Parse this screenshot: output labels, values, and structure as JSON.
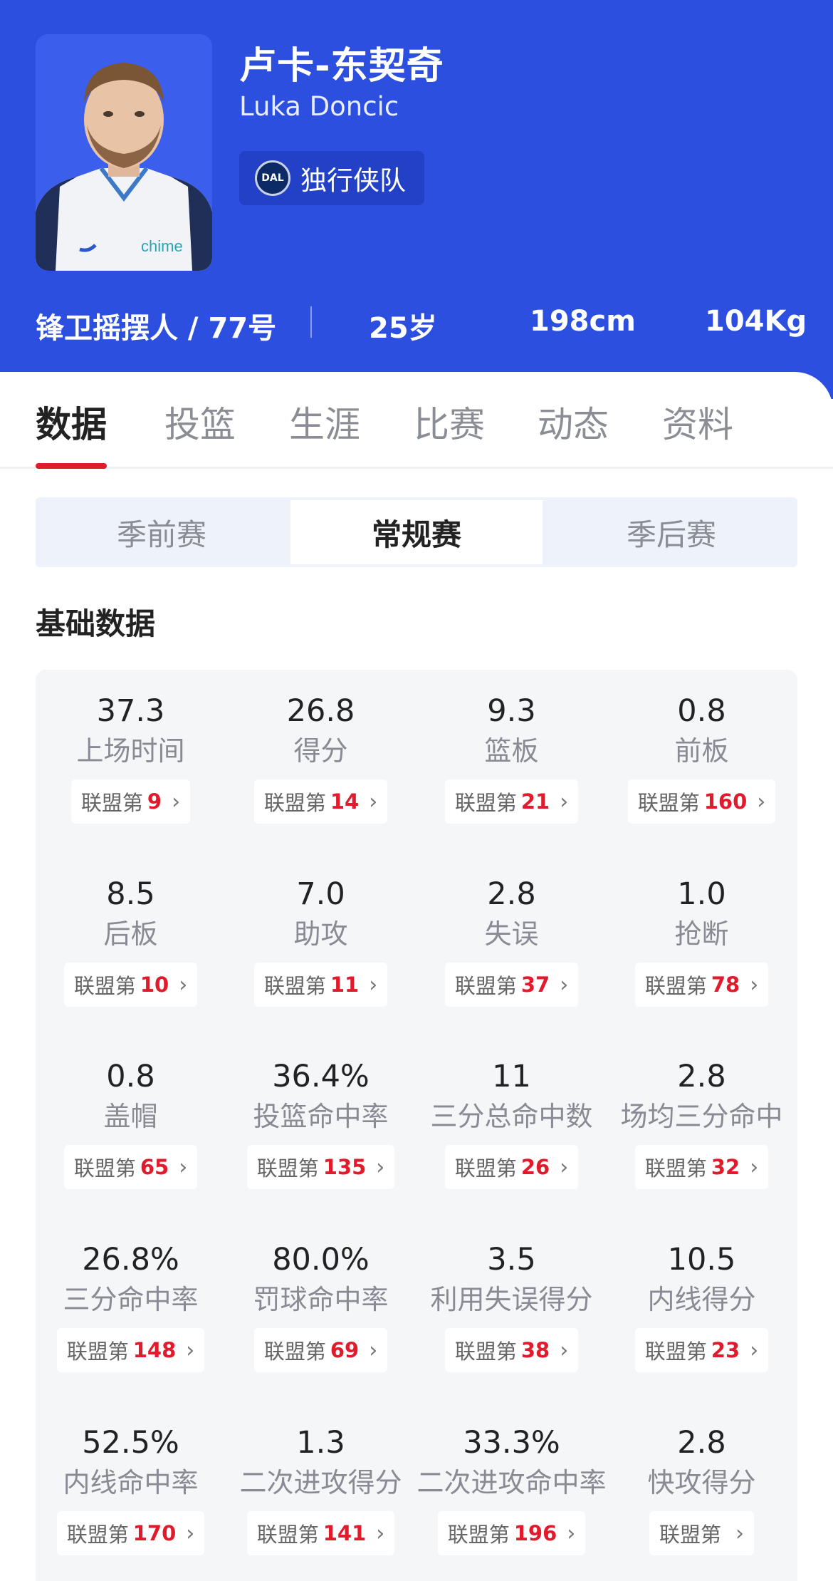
{
  "player": {
    "name_cn": "卢卡-东契奇",
    "name_en": "Luka Doncic",
    "team": "独行侠队",
    "team_logo_text": "DAL",
    "jersey_text": "chime",
    "position_number": "锋卫摇摆人 / 77号",
    "age": "25岁",
    "height": "198cm",
    "weight": "104Kg"
  },
  "tabs": [
    "数据",
    "投篮",
    "生涯",
    "比赛",
    "动态",
    "资料"
  ],
  "season_types": [
    "季前赛",
    "常规赛",
    "季后赛"
  ],
  "active_season_type": "常规赛",
  "section_title": "基础数据",
  "rank_prefix": "联盟第",
  "stats": [
    {
      "value": "37.3",
      "label": "上场时间",
      "rank": "9"
    },
    {
      "value": "26.8",
      "label": "得分",
      "rank": "14"
    },
    {
      "value": "9.3",
      "label": "篮板",
      "rank": "21"
    },
    {
      "value": "0.8",
      "label": "前板",
      "rank": "160"
    },
    {
      "value": "8.5",
      "label": "后板",
      "rank": "10"
    },
    {
      "value": "7.0",
      "label": "助攻",
      "rank": "11"
    },
    {
      "value": "2.8",
      "label": "失误",
      "rank": "37"
    },
    {
      "value": "1.0",
      "label": "抢断",
      "rank": "78"
    },
    {
      "value": "0.8",
      "label": "盖帽",
      "rank": "65"
    },
    {
      "value": "36.4%",
      "label": "投篮命中率",
      "rank": "135"
    },
    {
      "value": "11",
      "label": "三分总命中数",
      "rank": "26"
    },
    {
      "value": "2.8",
      "label": "场均三分命中",
      "rank": "32"
    },
    {
      "value": "26.8%",
      "label": "三分命中率",
      "rank": "148"
    },
    {
      "value": "80.0%",
      "label": "罚球命中率",
      "rank": "69"
    },
    {
      "value": "3.5",
      "label": "利用失误得分",
      "rank": "38"
    },
    {
      "value": "10.5",
      "label": "内线得分",
      "rank": "23"
    },
    {
      "value": "52.5%",
      "label": "内线命中率",
      "rank": "170"
    },
    {
      "value": "1.3",
      "label": "二次进攻得分",
      "rank": "141"
    },
    {
      "value": "33.3%",
      "label": "二次进攻命中率",
      "rank": "196"
    },
    {
      "value": "2.8",
      "label": "快攻得分",
      "rank": ""
    }
  ],
  "colors": {
    "header_bg": "#2c4fe0",
    "accent_red": "#e11b2c"
  }
}
